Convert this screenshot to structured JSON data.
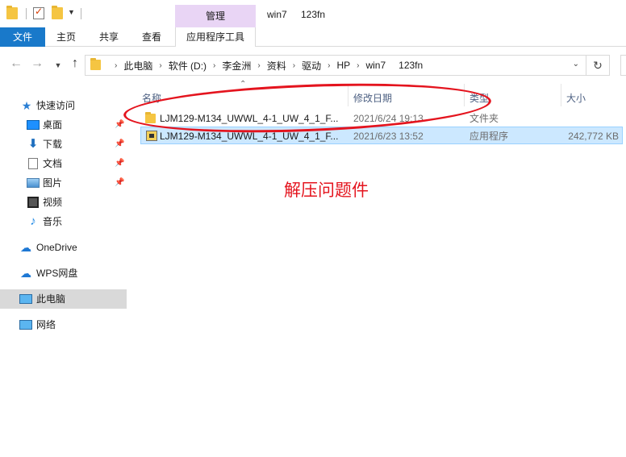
{
  "titlebar": {
    "context_tab": "管理",
    "path_title": "win7",
    "folder_title": "123fn"
  },
  "ribbon": {
    "tabs": [
      "文件",
      "主页",
      "共享",
      "查看",
      "应用程序工具"
    ]
  },
  "address": {
    "crumbs": [
      "此电脑",
      "软件 (D:)",
      "李金洲",
      "资料",
      "驱动",
      "HP",
      "win7",
      "123fn"
    ]
  },
  "sidebar": {
    "quick_access": "快速访问",
    "items": [
      {
        "label": "桌面",
        "icon": "desktop-icon",
        "pinned": true
      },
      {
        "label": "下载",
        "icon": "download-icon",
        "pinned": true
      },
      {
        "label": "文档",
        "icon": "document-icon",
        "pinned": true
      },
      {
        "label": "图片",
        "icon": "pictures-icon",
        "pinned": true
      },
      {
        "label": "视频",
        "icon": "video-icon",
        "pinned": false
      },
      {
        "label": "音乐",
        "icon": "music-icon",
        "pinned": false
      }
    ],
    "onedrive": "OneDrive",
    "wps": "WPS网盘",
    "this_pc": "此电脑",
    "network": "网络"
  },
  "list": {
    "columns": [
      "名称",
      "修改日期",
      "类型",
      "大小"
    ],
    "rows": [
      {
        "name": "LJM129-M134_UWWL_4-1_UW_4_1_F...",
        "date": "2021/6/24 19:13",
        "type": "文件夹",
        "size": "",
        "icon": "folder-icon",
        "selected": false
      },
      {
        "name": "LJM129-M134_UWWL_4-1_UW_4_1_F...",
        "date": "2021/6/23 13:52",
        "type": "应用程序",
        "size": "242,772 KB",
        "icon": "exe-icon",
        "selected": true
      }
    ]
  },
  "annotation": {
    "text": "解压问题件",
    "color": "#e4141e"
  },
  "colors": {
    "accent": "#1979ca",
    "context_tab_bg": "#e9d5f5",
    "selection_bg": "#cce8ff"
  }
}
